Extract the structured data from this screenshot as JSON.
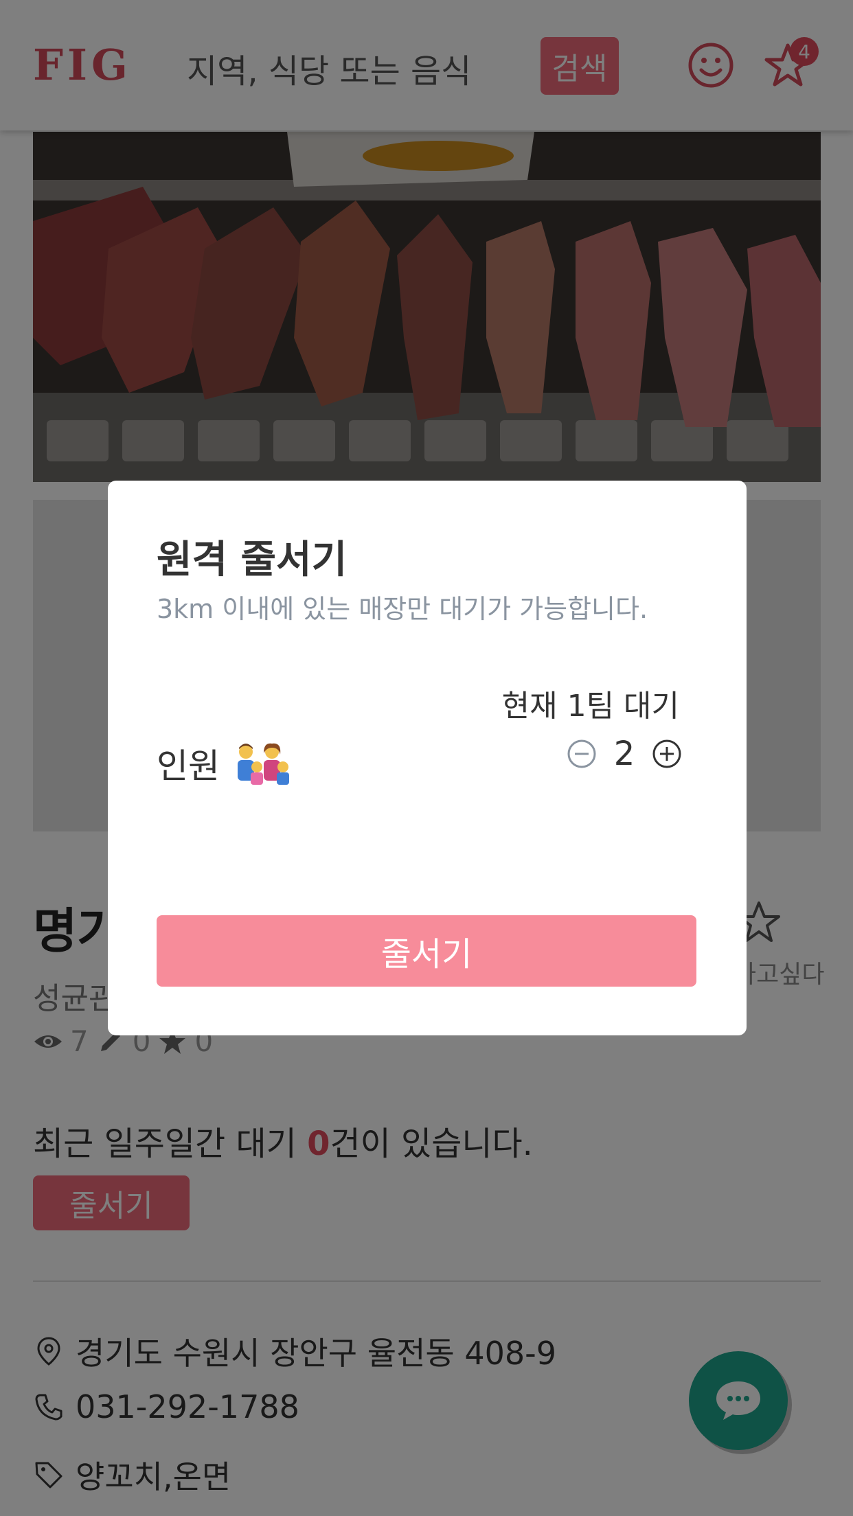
{
  "header": {
    "logo": "FIG",
    "search_placeholder": "지역, 식당 또는 음식",
    "search_button": "검색",
    "favorites_badge": "4"
  },
  "restaurant": {
    "name": "명가",
    "area": "성균관",
    "favorite_label": "가고싶다",
    "stats": {
      "views": "7",
      "reviews": "0",
      "favorites": "0"
    },
    "recent_text_before": "최근 일주일간 대기 ",
    "recent_count": "0",
    "recent_text_after": "건이 있습니다.",
    "queue_button": "줄서기",
    "address": "경기도 수원시 장안구 율전동 408-9",
    "phone": "031-292-1788",
    "tags": "양꼬치,온면"
  },
  "modal": {
    "title": "원격 줄서기",
    "subtitle": "3km 이내에 있는 매장만 대기가 가능합니다.",
    "current_wait": "현재 1팀 대기",
    "people_label": "인원",
    "people_count": "2",
    "submit_button": "줄서기"
  },
  "colors": {
    "brand": "#d24a5b",
    "button_pink": "#f78c9a",
    "chat_green": "#1ea48d"
  }
}
